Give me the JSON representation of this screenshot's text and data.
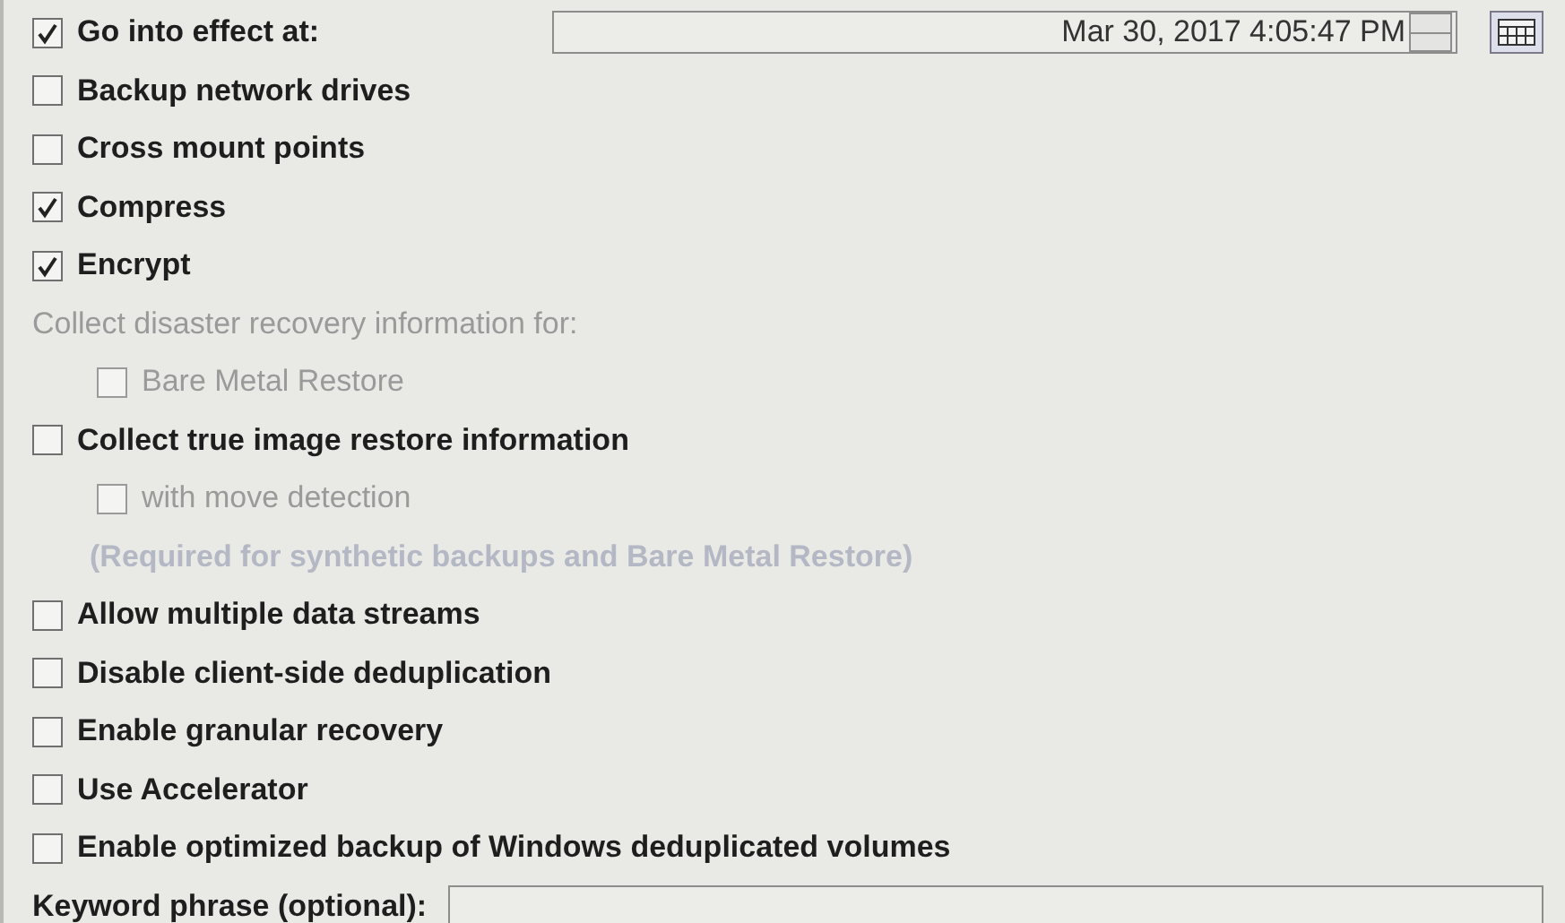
{
  "options": [
    {
      "kind": "datetime",
      "label": "Go into effect at:",
      "checked": true,
      "disabled": false,
      "value": "Mar 30, 2017 4:05:47 PM"
    },
    {
      "kind": "checkbox",
      "label": "Backup network drives",
      "checked": false,
      "disabled": false
    },
    {
      "kind": "checkbox",
      "label": "Cross mount points",
      "checked": false,
      "disabled": false
    },
    {
      "kind": "checkbox",
      "label": "Compress",
      "checked": true,
      "disabled": false
    },
    {
      "kind": "checkbox",
      "label": "Encrypt",
      "checked": true,
      "disabled": false
    },
    {
      "kind": "heading",
      "label": "Collect disaster recovery information for:",
      "children": [
        {
          "kind": "checkbox",
          "label": "Bare Metal Restore",
          "checked": false,
          "disabled": true
        }
      ]
    },
    {
      "kind": "checkbox",
      "label": "Collect true image restore information",
      "checked": false,
      "disabled": false,
      "children": [
        {
          "kind": "checkbox",
          "label": "with move detection",
          "checked": false,
          "disabled": true
        },
        {
          "kind": "note",
          "label": "(Required for synthetic backups and Bare Metal Restore)"
        }
      ]
    },
    {
      "kind": "checkbox",
      "label": "Allow multiple data streams",
      "checked": false,
      "disabled": false
    },
    {
      "kind": "checkbox",
      "label": "Disable client-side deduplication",
      "checked": false,
      "disabled": false
    },
    {
      "kind": "checkbox",
      "label": "Enable granular recovery",
      "checked": false,
      "disabled": false
    },
    {
      "kind": "checkbox",
      "label": "Use Accelerator",
      "checked": false,
      "disabled": false
    },
    {
      "kind": "checkbox",
      "label": "Enable optimized backup of Windows deduplicated volumes",
      "checked": false,
      "disabled": false
    },
    {
      "kind": "text",
      "label": "Keyword phrase (optional):"
    }
  ]
}
